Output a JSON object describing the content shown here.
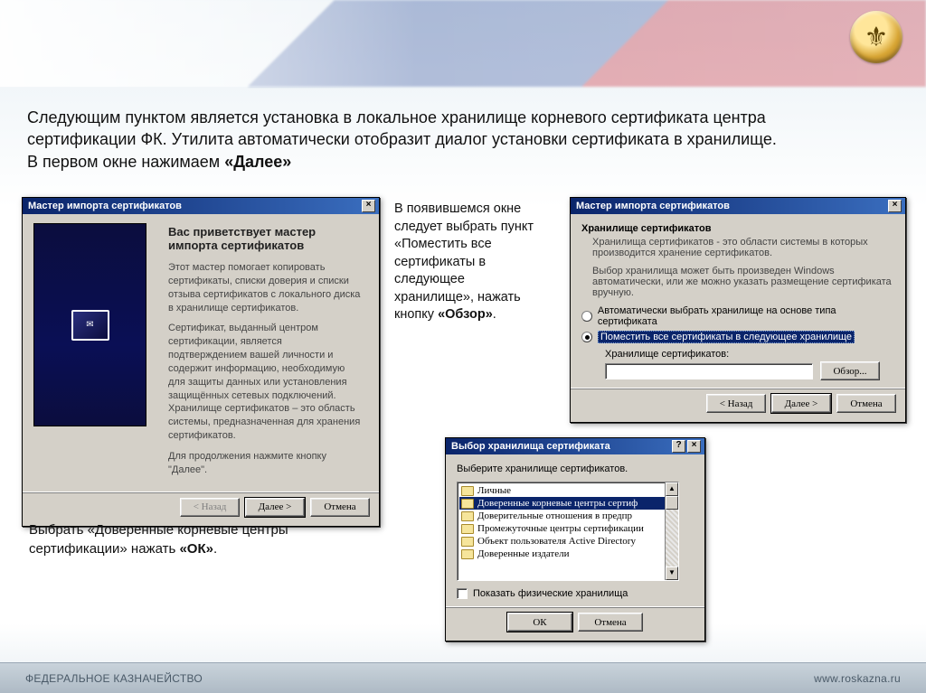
{
  "headline_parts": {
    "p1": "Следующим пунктом является установка в локальное хранилище корневого сертификата центра сертификации ФК.  Утилита автоматически отобразит диалог установки сертификата в хранилище. В первом окне нажимаем ",
    "p2": "«Далее»"
  },
  "note_mid": {
    "p1": "В появившемся окне следует выбрать пункт «Поместить все сертификаты в следующее хранилище», нажать кнопку ",
    "p2": "«Обзор»",
    "p3": "."
  },
  "note_left": {
    "p1": "Выбрать «Доверенные корневые центры сертификации» нажать  ",
    "p2": "«ОК»",
    "p3": "."
  },
  "wiz1": {
    "title": "Мастер импорта сертификатов",
    "heading": "Вас приветствует мастер импорта сертификатов",
    "para1": "Этот мастер помогает копировать сертификаты, списки доверия и списки отзыва сертификатов с локального диска в хранилище сертификатов.",
    "para2": "Сертификат, выданный центром сертификации, является подтверждением вашей личности и содержит информацию, необходимую для защиты данных или установления защищённых сетевых подключений. Хранилище сертификатов – это область системы, предназначенная для хранения сертификатов.",
    "para3": "Для продолжения нажмите кнопку \"Далее\".",
    "btn_back": "< Назад",
    "btn_next": "Далее >",
    "btn_cancel": "Отмена"
  },
  "wiz2": {
    "title": "Мастер импорта сертификатов",
    "group_title": "Хранилище сертификатов",
    "desc": "Хранилища сертификатов - это области системы в которых производится хранение сертификатов.",
    "hint": "Выбор хранилища может быть произведен Windows автоматически, или же можно указать размещение сертификата вручную.",
    "radio_auto": "Автоматически выбрать хранилище на основе типа сертификата",
    "radio_place": "Поместить все сертификаты в следующее хранилище",
    "field_label": "Хранилище сертификатов:",
    "browse": "Обзор...",
    "btn_back": "< Назад",
    "btn_next": "Далее >",
    "btn_cancel": "Отмена"
  },
  "dlg3": {
    "title": "Выбор хранилища сертификата",
    "prompt": "Выберите хранилище сертификатов.",
    "items": [
      "Личные",
      "Доверенные корневые центры сертиф",
      "Доверительные отношения в предпр",
      "Промежуточные центры сертификации",
      "Объект пользователя Active Directory",
      "Доверенные издатели"
    ],
    "selected_index": 1,
    "show_physical": "Показать физические хранилища",
    "btn_ok": "ОК",
    "btn_cancel": "Отмена"
  },
  "footer": {
    "left": "ФЕДЕРАЛЬНОЕ КАЗНАЧЕЙСТВО",
    "right": "www.roskazna.ru"
  }
}
